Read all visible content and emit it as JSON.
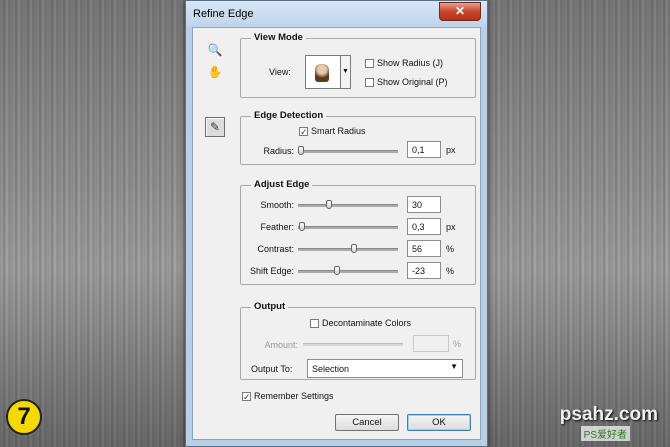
{
  "window": {
    "title": "Refine Edge",
    "close_glyph": "✕"
  },
  "tools": [
    {
      "icon": "zoom-icon",
      "glyph": "🔍"
    },
    {
      "icon": "hand-icon",
      "glyph": "✋"
    },
    {
      "icon": "refine-radius-brush-icon",
      "glyph": "✎"
    }
  ],
  "view_mode": {
    "title": "View Mode",
    "view_label": "View:",
    "show_radius": {
      "label": "Show Radius (J)",
      "checked": false
    },
    "show_original": {
      "label": "Show Original (P)",
      "checked": false
    }
  },
  "edge_detection": {
    "title": "Edge Detection",
    "smart_radius": {
      "label": "Smart Radius",
      "checked": true
    },
    "radius": {
      "label": "Radius:",
      "value": "0,1",
      "unit": "px",
      "level": 0.0
    }
  },
  "adjust_edge": {
    "title": "Adjust Edge",
    "rows": [
      {
        "label": "Smooth:",
        "value": "30",
        "unit": "",
        "level": 0.3
      },
      {
        "label": "Feather:",
        "value": "0,3",
        "unit": "px",
        "level": 0.01
      },
      {
        "label": "Contrast:",
        "value": "56",
        "unit": "%",
        "level": 0.56
      },
      {
        "label": "Shift Edge:",
        "value": "-23",
        "unit": "%",
        "level": 0.385
      }
    ]
  },
  "output": {
    "title": "Output",
    "decontaminate": {
      "label": "Decontaminate Colors",
      "checked": false
    },
    "amount": {
      "label": "Amount:",
      "value": "",
      "unit": "%"
    },
    "output_to": {
      "label": "Output To:",
      "value": "Selection"
    }
  },
  "remember": {
    "label": "Remember Settings",
    "checked": true
  },
  "buttons": {
    "cancel": "Cancel",
    "ok": "OK"
  },
  "overlay": {
    "step": "7",
    "watermark": "psahz.com",
    "watermark_sub": "PS爱好者"
  },
  "check_glyph": "✓"
}
